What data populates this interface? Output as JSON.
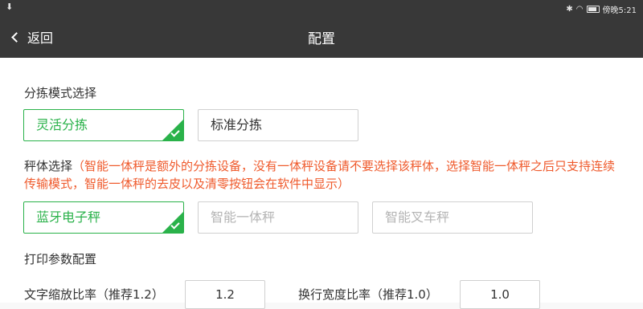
{
  "status_bar": {
    "time": "傍晚5:21"
  },
  "header": {
    "back_label": "返回",
    "title": "配置"
  },
  "sort_mode": {
    "label": "分拣模式选择",
    "options": [
      {
        "label": "灵活分拣",
        "selected": true
      },
      {
        "label": "标准分拣",
        "selected": false
      }
    ]
  },
  "scale": {
    "label": "秤体选择",
    "note": "（智能一体秤是额外的分拣设备，没有一体秤设备请不要选择该秤体，选择智能一体秤之后只支持连续传输模式，智能一体秤的去皮以及清零按钮会在软件中显示）",
    "options": [
      {
        "label": "蓝牙电子秤",
        "selected": true
      },
      {
        "label": "智能一体秤",
        "selected": false
      },
      {
        "label": "智能叉车秤",
        "selected": false
      }
    ]
  },
  "print": {
    "label": "打印参数配置",
    "text_scale_label": "文字缩放比率（推荐1.2）",
    "text_scale_value": "1.2",
    "line_width_label": "换行宽度比率（推荐1.0）",
    "line_width_value": "1.0"
  },
  "colors": {
    "accent": "#2ab24a",
    "warning": "#ef5a2c",
    "bar": "#383838"
  }
}
